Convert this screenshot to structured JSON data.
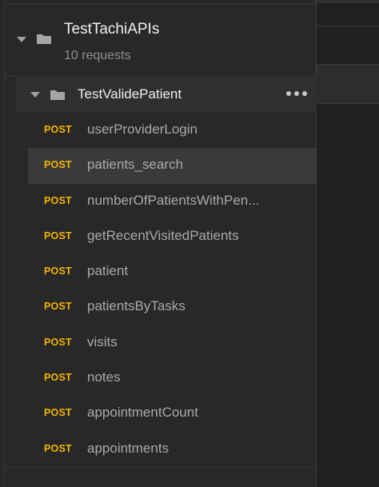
{
  "collection": {
    "name": "TestTachiAPIs",
    "count": "10 requests",
    "caret_icon": "caret-down-icon",
    "folder_icon": "folder-icon"
  },
  "folder": {
    "name": "TestValidePatient",
    "caret_icon": "caret-down-icon",
    "folder_icon": "folder-icon",
    "more_icon": "more-horizontal-icon"
  },
  "requests": [
    {
      "method": "POST",
      "name": "userProviderLogin",
      "active": false
    },
    {
      "method": "POST",
      "name": "patients_search",
      "active": true
    },
    {
      "method": "POST",
      "name": "numberOfPatientsWithPen...",
      "active": false
    },
    {
      "method": "POST",
      "name": "getRecentVisitedPatients",
      "active": false
    },
    {
      "method": "POST",
      "name": "patient",
      "active": false
    },
    {
      "method": "POST",
      "name": "patientsByTasks",
      "active": false
    },
    {
      "method": "POST",
      "name": "visits",
      "active": false
    },
    {
      "method": "POST",
      "name": "notes",
      "active": false
    },
    {
      "method": "POST",
      "name": "appointmentCount",
      "active": false
    },
    {
      "method": "POST",
      "name": "appointments",
      "active": false
    }
  ],
  "colors": {
    "method_post": "#f4b400",
    "panel_bg": "#282828",
    "active_row_bg": "#3a3a3a",
    "folder_row_bg": "#2f2f2f",
    "request_text": "#a9a9a9",
    "secondary_text": "#8f8f8f"
  }
}
